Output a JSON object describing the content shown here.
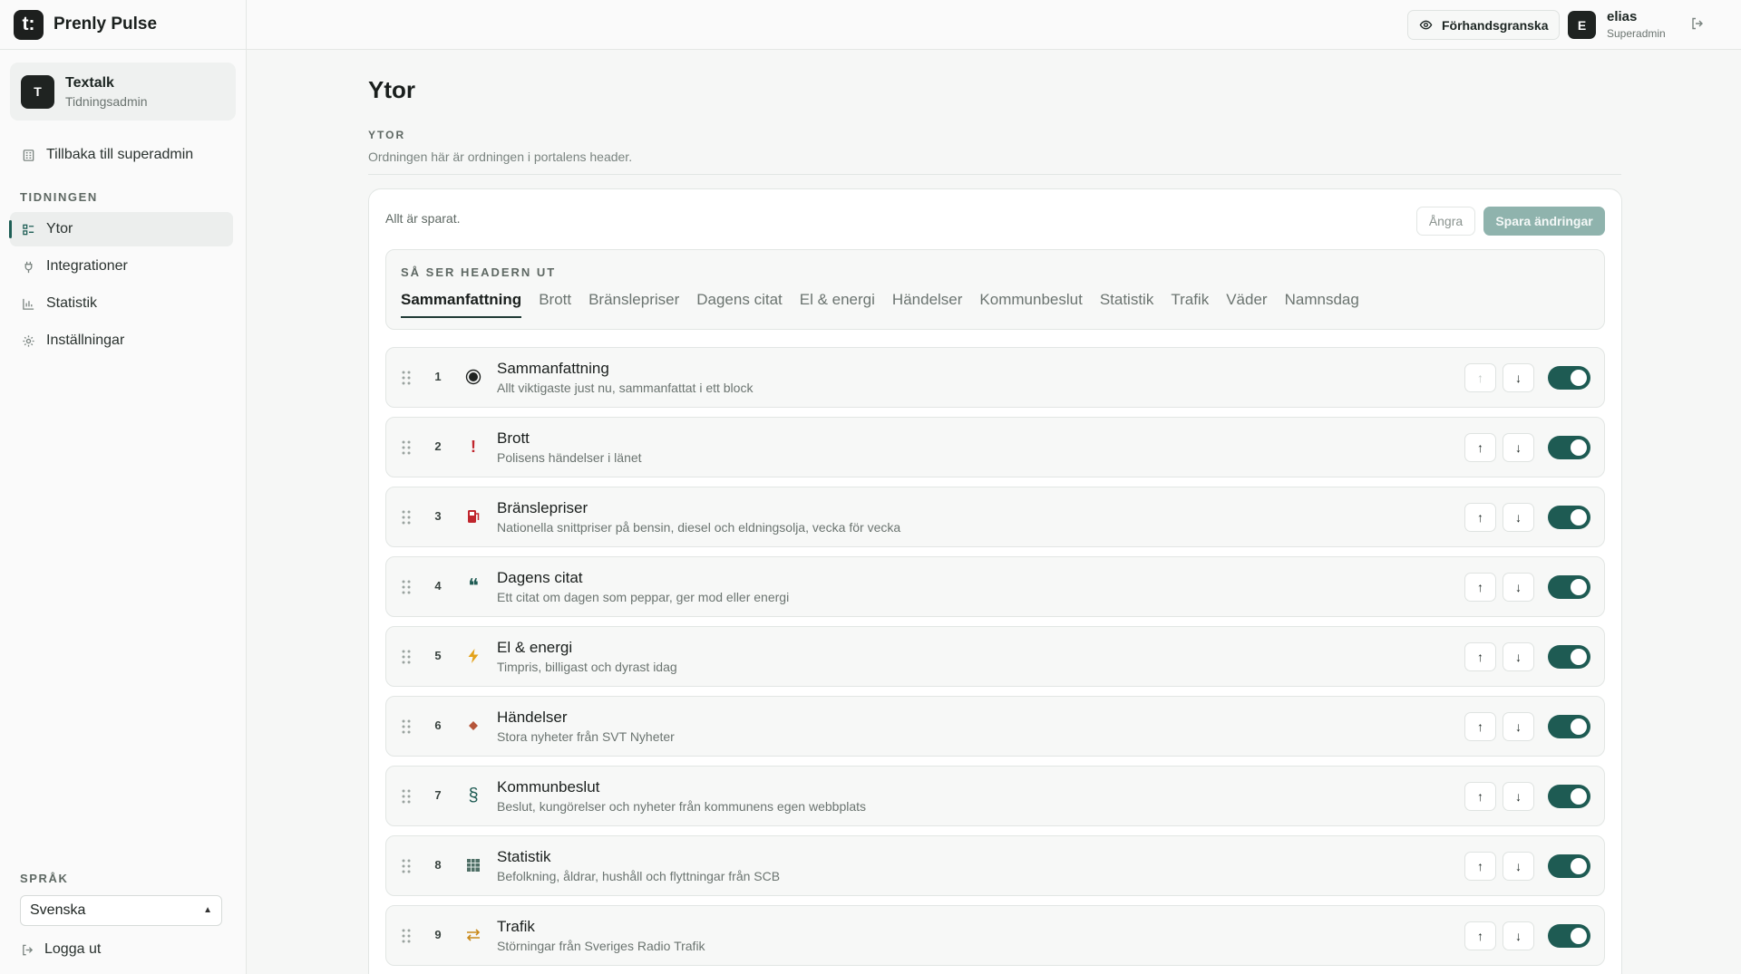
{
  "brand": {
    "name": "Prenly Pulse",
    "logo_text": "t:"
  },
  "org": {
    "avatar": "T",
    "name": "Textalk",
    "role": "Tidningsadmin"
  },
  "nav": {
    "back_label": "Tillbaka till superadmin",
    "section_label": "TIDNINGEN",
    "items": [
      {
        "label": "Ytor",
        "icon": "layout-list-icon"
      },
      {
        "label": "Integrationer",
        "icon": "plug-icon"
      },
      {
        "label": "Statistik",
        "icon": "bar-chart-icon"
      },
      {
        "label": "Inställningar",
        "icon": "gear-icon"
      }
    ],
    "language_label": "SPRÅK",
    "language_value": "Svenska",
    "logout_label": "Logga ut"
  },
  "topbar": {
    "preview_label": "Förhandsgranska",
    "user_avatar": "E",
    "user_name": "elias",
    "user_role": "Superadmin"
  },
  "main": {
    "title": "Ytor",
    "section_label": "YTOR",
    "section_desc": "Ordningen här är ordningen i portalens header.",
    "saved_status": "Allt är sparat.",
    "undo_label": "Ångra",
    "save_label": "Spara ändringar",
    "header_preview_label": "SÅ SER HEADERN UT",
    "header_tabs": [
      "Sammanfattning",
      "Brott",
      "Bränslepriser",
      "Dagens citat",
      "El & energi",
      "Händelser",
      "Kommunbeslut",
      "Statistik",
      "Trafik",
      "Väder",
      "Namnsdag"
    ],
    "rows": [
      {
        "index": "1",
        "icon": "●",
        "icon_color": "#1f2321",
        "title": "Sammanfattning",
        "desc": "Allt viktigaste just nu, sammanfattat i ett block",
        "enabled": true,
        "up_disabled": true
      },
      {
        "index": "2",
        "icon": "!",
        "icon_color": "#c0262d",
        "title": "Brott",
        "desc": "Polisens händelser i länet",
        "enabled": true,
        "up_disabled": false
      },
      {
        "index": "3",
        "icon": "⛽",
        "icon_color": "#c0262d",
        "title": "Bränslepriser",
        "desc": "Nationella snittpriser på bensin, diesel och eldningsolja, vecka för vecka",
        "enabled": true,
        "up_disabled": false
      },
      {
        "index": "4",
        "icon": "❝",
        "icon_color": "#1e5b53",
        "title": "Dagens citat",
        "desc": "Ett citat om dagen som peppar, ger mod eller energi",
        "enabled": true,
        "up_disabled": false
      },
      {
        "index": "5",
        "icon": "⚡",
        "icon_color": "#e3a21a",
        "title": "El & energi",
        "desc": "Timpris, billigast och dyrast idag",
        "enabled": true,
        "up_disabled": false
      },
      {
        "index": "6",
        "icon": "◆",
        "icon_color": "#b5553a",
        "title": "Händelser",
        "desc": "Stora nyheter från SVT Nyheter",
        "enabled": true,
        "up_disabled": false
      },
      {
        "index": "7",
        "icon": "§",
        "icon_color": "#1e5b53",
        "title": "Kommunbeslut",
        "desc": "Beslut, kungörelser och nyheter från kommunens egen webbplats",
        "enabled": true,
        "up_disabled": false
      },
      {
        "index": "8",
        "icon": "▦",
        "icon_color": "#4f6f66",
        "title": "Statistik",
        "desc": "Befolkning, åldrar, hushåll och flyttningar från SCB",
        "enabled": true,
        "up_disabled": false
      },
      {
        "index": "9",
        "icon": "⇄",
        "icon_color": "#c98a1c",
        "title": "Trafik",
        "desc": "Störningar från Sveriges Radio Trafik",
        "enabled": true,
        "up_disabled": false
      }
    ]
  }
}
